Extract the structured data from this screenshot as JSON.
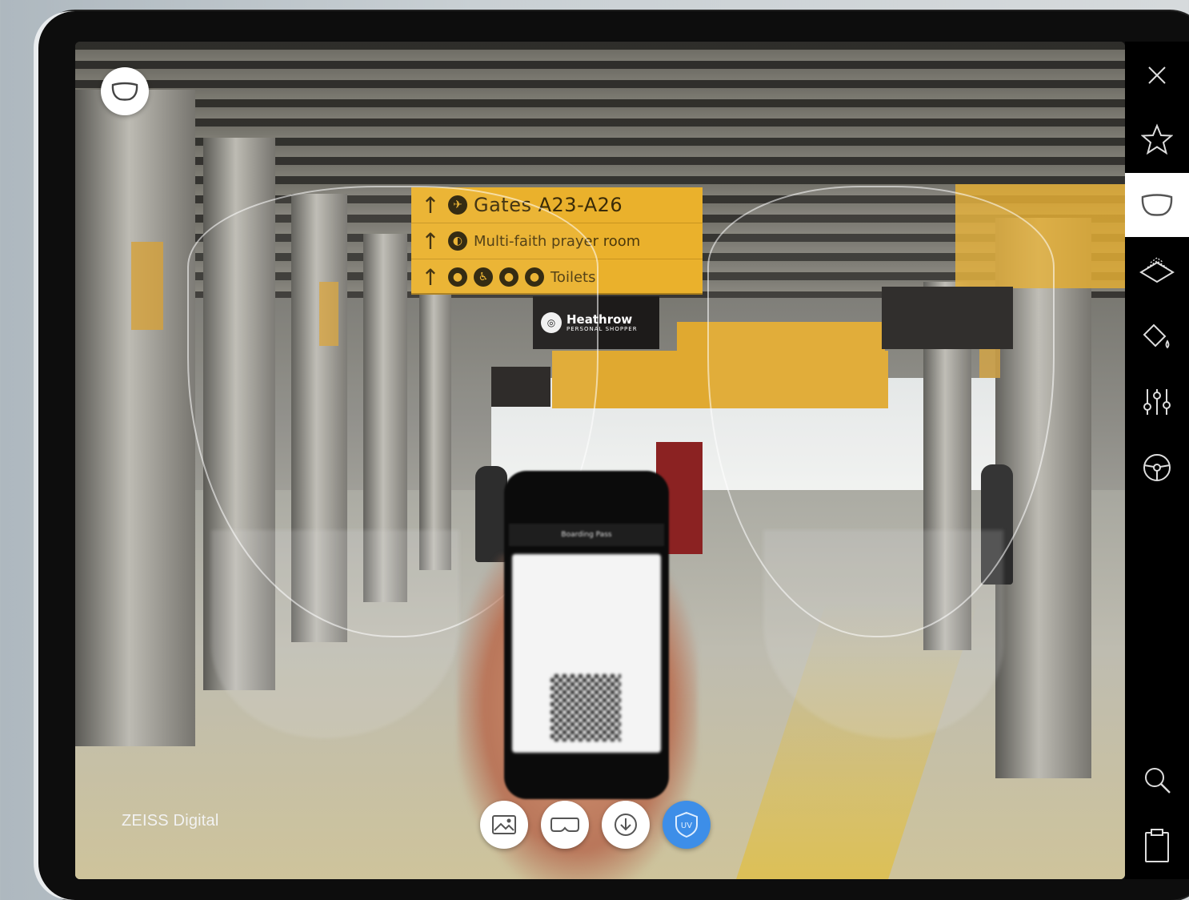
{
  "scene": {
    "sign_main": {
      "rows": [
        {
          "arrow": "↑",
          "icon": "plane",
          "text": "Gates A23-A26"
        },
        {
          "arrow": "↑",
          "icon": "prayer",
          "text": "Multi-faith prayer room"
        },
        {
          "arrow": "↑",
          "icon": "toilets",
          "text": "Toilets"
        }
      ]
    },
    "shop_sign": {
      "title": "Heathrow",
      "subtitle": "PERSONAL SHOPPER"
    },
    "phone": {
      "header": "Boarding Pass"
    }
  },
  "brand": {
    "label": "ZEISS Digital"
  },
  "top_left_button": {
    "icon": "lens-frame-icon"
  },
  "bottom_controls": [
    {
      "name": "image-button",
      "icon": "image-icon",
      "active": false
    },
    {
      "name": "vr-glasses-button",
      "icon": "vr-headset-icon",
      "active": false
    },
    {
      "name": "download-button",
      "icon": "download-icon",
      "active": false
    },
    {
      "name": "uv-protection-button",
      "icon": "uv-shield-icon",
      "label": "UV",
      "active": true
    }
  ],
  "toolbar": {
    "items": [
      {
        "name": "close",
        "icon": "close-icon"
      },
      {
        "name": "favorites",
        "icon": "star-icon"
      },
      {
        "name": "lens-shape",
        "icon": "lens-frame-icon",
        "selected": true
      },
      {
        "name": "layers",
        "icon": "layers-icon"
      },
      {
        "name": "tint",
        "icon": "paint-bucket-icon"
      },
      {
        "name": "adjustments",
        "icon": "sliders-icon"
      },
      {
        "name": "steering",
        "icon": "steering-wheel-icon"
      },
      {
        "name": "search",
        "icon": "search-icon"
      },
      {
        "name": "clipboard",
        "icon": "clipboard-icon"
      }
    ]
  },
  "colors": {
    "accent": "#3d8ee8",
    "sign_yellow": "#eab12c"
  }
}
